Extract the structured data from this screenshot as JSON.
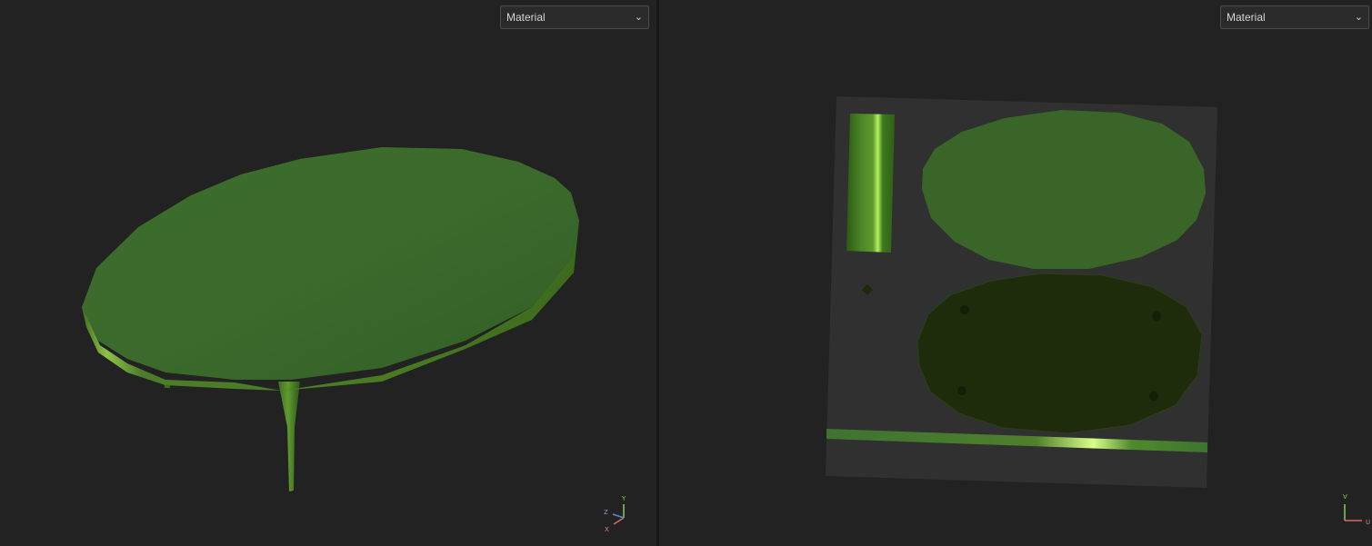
{
  "left_viewport": {
    "mode_select": {
      "value": "Material"
    },
    "gizmo": {
      "axis_y": "Y",
      "axis_z": "Z",
      "axis_x": "X"
    }
  },
  "right_viewport": {
    "mode_select": {
      "value": "Material"
    },
    "gizmo": {
      "axis_v": "V",
      "axis_u": "U"
    }
  },
  "colors": {
    "background": "#222222",
    "material_green": "#3e6b2c",
    "uv_tile": "#303030",
    "dark_green": "#1d2b0c",
    "highlight_green": "#b6f060",
    "axis_y": "#7cd15a",
    "axis_x": "#d96a6a",
    "axis_z": "#6a7fd9"
  },
  "icons": [
    "chevron-down-icon",
    "axis-gizmo-icon",
    "uv-axis-gizmo-icon"
  ]
}
